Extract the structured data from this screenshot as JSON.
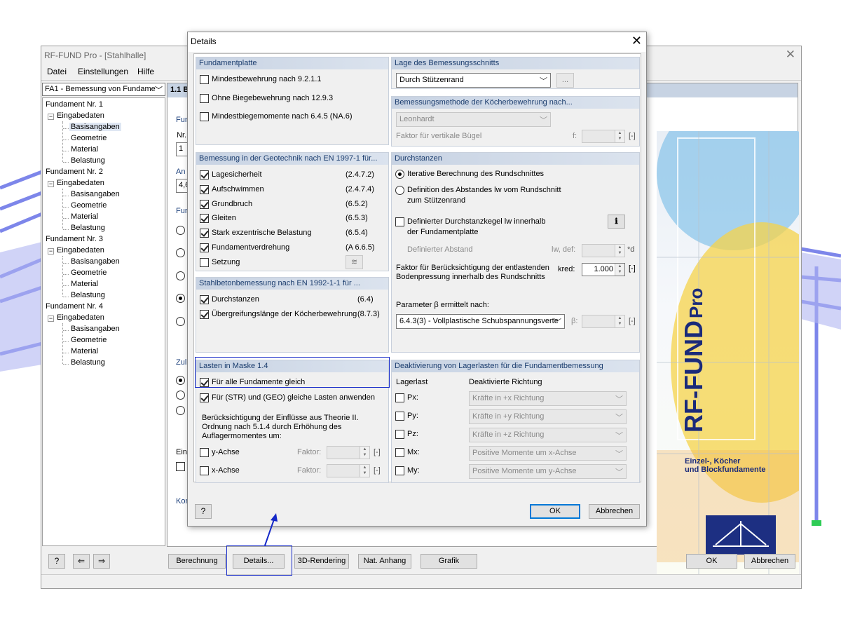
{
  "main_window": {
    "title": "RF-FUND Pro - [Stahlhalle]",
    "menu": [
      "Datei",
      "Einstellungen",
      "Hilfe"
    ],
    "case_selector": "FA1 - Bemessung von Fundame",
    "content_header": "1.1 B",
    "tree": {
      "foundations": [
        {
          "label": "Fundament Nr. 1",
          "group": "Eingabedaten",
          "children": [
            "Basisangaben",
            "Geometrie",
            "Material",
            "Belastung"
          ]
        },
        {
          "label": "Fundament Nr. 2",
          "group": "Eingabedaten",
          "children": [
            "Basisangaben",
            "Geometrie",
            "Material",
            "Belastung"
          ]
        },
        {
          "label": "Fundament Nr. 3",
          "group": "Eingabedaten",
          "children": [
            "Basisangaben",
            "Geometrie",
            "Material",
            "Belastung"
          ]
        },
        {
          "label": "Fundament Nr. 4",
          "group": "Eingabedaten",
          "children": [
            "Basisangaben",
            "Geometrie",
            "Material",
            "Belastung"
          ]
        }
      ]
    },
    "partial": {
      "fun1": "Fun",
      "nr": "Nr.:",
      "nr_value": "1",
      "an": "An",
      "an_value": "4,6",
      "fun2": "Fun",
      "zul": "Zul",
      "eins": "Eins",
      "kom": "Kon"
    },
    "splash": {
      "product": "RF-FUND",
      "pro": "Pro",
      "subtitle_line1": "Einzel-, Köcher",
      "subtitle_line2": "und Blockfundamente"
    },
    "buttons": {
      "berechnung": "Berechnung",
      "details": "Details...",
      "rendering": "3D-Rendering",
      "anhang": "Nat. Anhang",
      "grafik": "Grafik",
      "ok": "OK",
      "abbrechen": "Abbrechen"
    }
  },
  "dialog": {
    "title": "Details",
    "fundamentplatte": {
      "header": "Fundamentplatte",
      "items": [
        {
          "label": "Mindestbewehrung nach 9.2.1.1",
          "checked": false
        },
        {
          "label": "Ohne Biegebewehrung nach 12.9.3",
          "checked": false
        },
        {
          "label": "Mindestbiegemomente nach 6.4.5 (NA.6)",
          "checked": false
        }
      ]
    },
    "geotechnik": {
      "header": "Bemessung in der Geotechnik nach EN 1997-1 für...",
      "items": [
        {
          "label": "Lagesicherheit",
          "ref": "(2.4.7.2)",
          "checked": true
        },
        {
          "label": "Aufschwimmen",
          "ref": "(2.4.7.4)",
          "checked": true
        },
        {
          "label": "Grundbruch",
          "ref": "(6.5.2)",
          "checked": true
        },
        {
          "label": "Gleiten",
          "ref": "(6.5.3)",
          "checked": true
        },
        {
          "label": "Stark exzentrische Belastung",
          "ref": "(6.5.4)",
          "checked": true
        },
        {
          "label": "Fundamentverdrehung",
          "ref": "(A 6.6.5)",
          "checked": true
        },
        {
          "label": "Setzung",
          "ref": "",
          "checked": false
        }
      ]
    },
    "stahlbeton": {
      "header": "Stahlbetonbemessung nach EN 1992-1-1 für ...",
      "items": [
        {
          "label": "Durchstanzen",
          "ref": "(6.4)",
          "checked": true
        },
        {
          "label": "Übergreifungslänge der Köcherbewehrung",
          "ref": "(8.7.3)",
          "checked": true
        }
      ]
    },
    "lasten": {
      "header": "Lasten in Maske 1.4",
      "items": [
        {
          "label": "Für alle Fundamente gleich",
          "checked": true
        },
        {
          "label": "Für (STR) und (GEO) gleiche Lasten anwenden",
          "checked": true
        }
      ],
      "theorie_text": "Berücksichtigung der Einflüsse aus Theorie II. Ordnung nach 5.1.4 durch Erhöhung des Auflagermomentes um:",
      "axes": [
        {
          "label": "y-Achse",
          "factor_label": "Faktor:",
          "unit": "[-]",
          "checked": false
        },
        {
          "label": "x-Achse",
          "factor_label": "Faktor:",
          "unit": "[-]",
          "checked": false
        }
      ]
    },
    "bemessungsschnitt": {
      "header": "Lage des Bemessungsschnitts",
      "value": "Durch Stützenrand",
      "button": "..."
    },
    "koecher": {
      "header": "Bemessungsmethode der Köcherbewehrung nach...",
      "value": "Leonhardt",
      "faktor_label": "Faktor für vertikale Bügel",
      "symbol": "f:",
      "unit": "[-]"
    },
    "durchstanzen": {
      "header": "Durchstanzen",
      "radio1": "Iterative Berechnung des Rundschnittes",
      "radio2_line1": "Definition des Abstandes lw vom Rundschnitt",
      "radio2_line2": "zum Stützenrand",
      "check_line1": "Definierter Durchstanzkegel lw innerhalb",
      "check_line2": "der Fundamentplatte",
      "abstand_label": "Definierter Abstand",
      "abstand_symbol": "lw, def:",
      "abstand_unit": "*d",
      "kred_text_line1": "Faktor für Berücksichtigung der entlastenden",
      "kred_text_line2": "Bodenpressung innerhalb des Rundschnitts",
      "kred_symbol": "kred:",
      "kred_value": "1.000",
      "kred_unit": "[-]",
      "beta_label": "Parameter β ermittelt nach:",
      "beta_value": "6.4.3(3) - Vollplastische Schubspannungsverte",
      "beta_symbol": "β:",
      "beta_unit": "[-]"
    },
    "deaktivierung": {
      "header": "Deaktivierung von Lagerlasten für die Fundamentbemessung",
      "col1": "Lagerlast",
      "col2": "Deaktivierte Richtung",
      "rows": [
        {
          "load": "Px:",
          "direction": "Kräfte in +x Richtung"
        },
        {
          "load": "Py:",
          "direction": "Kräfte in +y Richtung"
        },
        {
          "load": "Pz:",
          "direction": "Kräfte in +z Richtung"
        },
        {
          "load": "Mx:",
          "direction": "Positive Momente um x-Achse"
        },
        {
          "load": "My:",
          "direction": "Positive Momente um y-Achse"
        }
      ]
    },
    "ok": "OK",
    "cancel": "Abbrechen"
  },
  "colors": {
    "group_header_text": "#1b3d6e",
    "highlight": "#1428c8",
    "splash_title": "#1a2a7a",
    "structure_blue": "#7f8cf0"
  }
}
